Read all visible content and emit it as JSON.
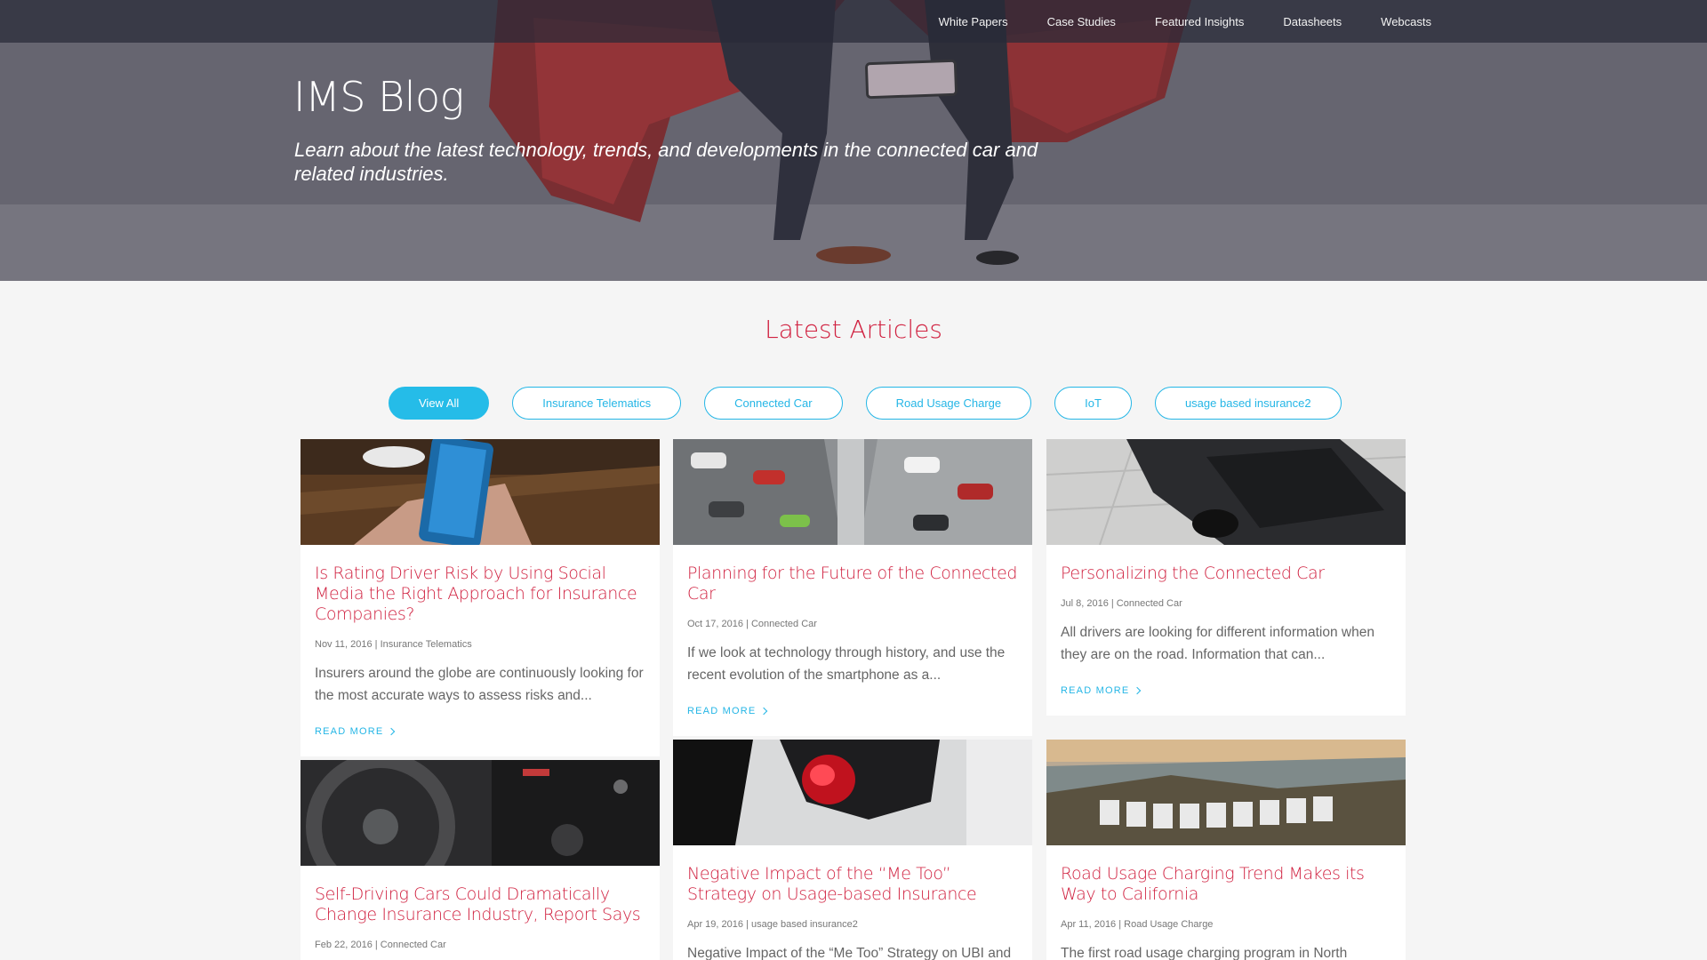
{
  "nav": {
    "items": [
      "White Papers",
      "Case Studies",
      "Featured Insights",
      "Datasheets",
      "Webcasts"
    ]
  },
  "hero": {
    "title": "IMS Blog",
    "subtitle": "Learn about the latest technology, trends, and developments in the connected car and related industries."
  },
  "section": {
    "title": "Latest Articles"
  },
  "filters": [
    "View All",
    "Insurance Telematics",
    "Connected Car",
    "Road Usage Charge",
    "IoT",
    "usage based insurance2"
  ],
  "colors": {
    "accent_red": "#d0203f",
    "accent_blue": "#25b6e6"
  },
  "articles": [
    {
      "title": "Is Rating Driver Risk by Using Social Media the Right Approach for Insurance Companies?",
      "meta": "Nov 11, 2016 | Insurance Telematics",
      "excerpt": "Insurers around the globe are continuously looking for the most accurate ways to assess risks and...",
      "read_more": "READ MORE"
    },
    {
      "title": "Planning for the Future of the Connected Car",
      "meta": "Oct 17, 2016 | Connected Car",
      "excerpt": "If we look at technology through history, and use the recent evolution of the smartphone as a...",
      "read_more": "READ MORE"
    },
    {
      "title": "Personalizing the Connected Car",
      "meta": "Jul 8, 2016 | Connected Car",
      "excerpt": "All drivers are looking for different information when they are on the road. Information that can...",
      "read_more": "READ MORE"
    },
    {
      "title": "Self-Driving Cars Could Dramatically Change Insurance Industry, Report Says",
      "meta": "Feb 22, 2016 | Connected Car"
    },
    {
      "title": "Negative Impact of the “Me Too” Strategy on Usage-based Insurance",
      "meta": "Apr 19, 2016 | usage based insurance2",
      "excerpt": "Negative Impact of the “Me Too” Strategy on UBI and"
    },
    {
      "title": "Road Usage Charging Trend Makes its Way to California",
      "meta": "Apr 11, 2016 | Road Usage Charge",
      "excerpt": "The first road usage charging program in North"
    }
  ]
}
